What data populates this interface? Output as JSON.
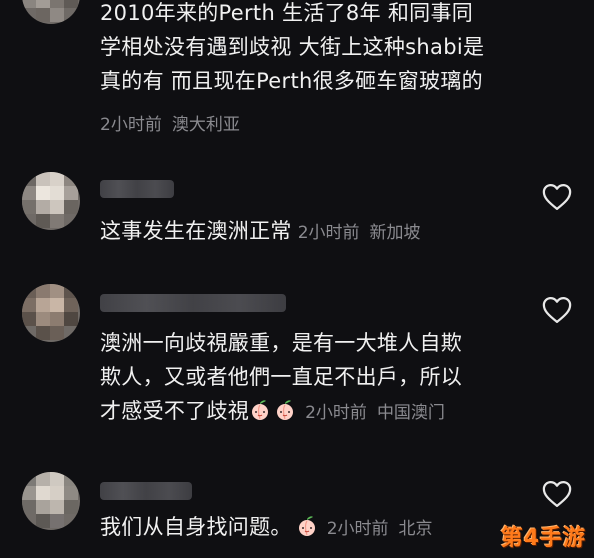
{
  "comments": [
    {
      "lines": [
        "2010年来的Perth 生活了8年 和同事同",
        "学相处没有遇到歧视 大街上这种shabi是",
        "真的有 而且现在Perth很多砸车窗玻璃的"
      ],
      "time": "2小时前",
      "location": "澳大利亚"
    },
    {
      "lines": [
        "这事发生在澳洲正常"
      ],
      "time": "2小时前",
      "location": "新加坡"
    },
    {
      "lines": [
        "澳洲一向歧視嚴重，是有一大堆人自欺",
        "欺人，又或者他們一直足不出戶，所以",
        "才感受不了歧視"
      ],
      "time": "2小时前",
      "location": "中国澳门"
    },
    {
      "lines": [
        "我们从自身找问题。"
      ],
      "time": "2小时前",
      "location": "北京"
    }
  ],
  "icons": {
    "like": "heart-outline-icon",
    "emoji": "peach-emoji-icon"
  },
  "watermark": "第4手游",
  "colors": {
    "background": "#0f0f12",
    "text": "#f1f1f1",
    "meta": "#8a8a8f",
    "watermark": "#ff7a1a"
  }
}
